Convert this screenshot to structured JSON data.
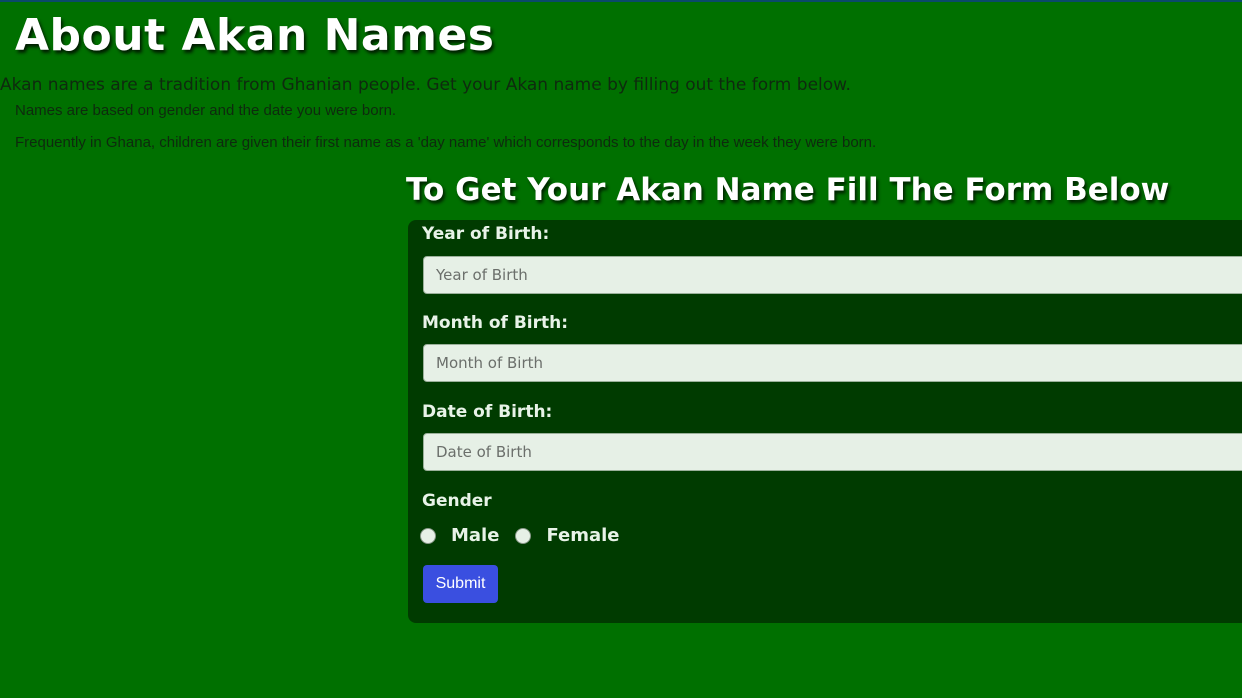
{
  "page": {
    "title": "About Akan Names",
    "intro": "Akan names are a tradition from Ghanian people. Get your Akan name by filling out the form below.",
    "notes": [
      "Names are based on gender and the date you were born.",
      "Frequently in Ghana, children are given their first name as a 'day name' which corresponds to the day in the week they were born."
    ]
  },
  "form": {
    "heading": "To Get Your Akan Name Fill The Form Below",
    "year": {
      "label": "Year of Birth:",
      "placeholder": "Year of Birth",
      "value": ""
    },
    "month": {
      "label": "Month of Birth:",
      "placeholder": "Month of Birth",
      "value": ""
    },
    "date": {
      "label": "Date of Birth:",
      "placeholder": "Date of Birth",
      "value": ""
    },
    "gender": {
      "label": "Gender",
      "options": [
        "Male",
        "Female"
      ],
      "selected": null
    },
    "submit_label": "Submit"
  },
  "colors": {
    "background": "#007000",
    "panel": "#003b00",
    "input_background": "#e6f0e6",
    "submit_button": "#3a4fe0"
  }
}
